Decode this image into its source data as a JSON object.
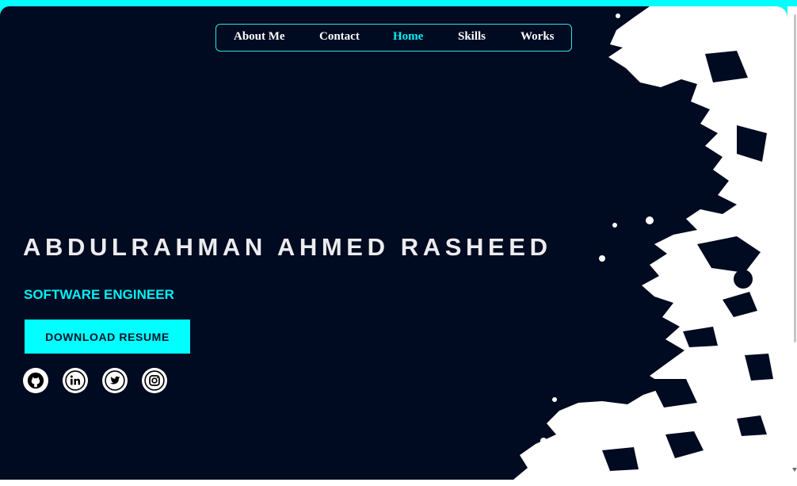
{
  "nav": {
    "items": [
      {
        "label": "About Me",
        "active": false
      },
      {
        "label": "Contact",
        "active": false
      },
      {
        "label": "Home",
        "active": true
      },
      {
        "label": "Skills",
        "active": false
      },
      {
        "label": "Works",
        "active": false
      }
    ]
  },
  "hero": {
    "name": "ABDULRAHMAN AHMED RASHEED",
    "role": "SOFTWARE ENGINEER",
    "resume_label": "DOWNLOAD RESUME"
  },
  "social": [
    {
      "icon": "github-icon"
    },
    {
      "icon": "linkedin-icon"
    },
    {
      "icon": "twitter-icon"
    },
    {
      "icon": "instagram-icon"
    }
  ],
  "colors": {
    "accent": "#00ffff",
    "background": "#000a20",
    "name_text": "#ecebee",
    "active_nav": "#00f2f5"
  }
}
